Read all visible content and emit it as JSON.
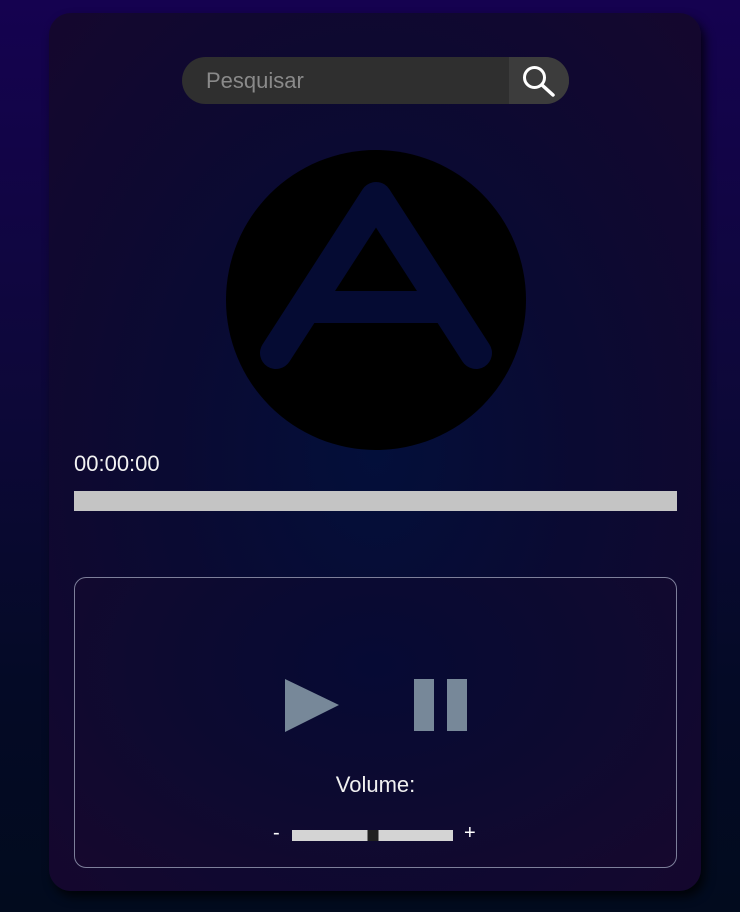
{
  "search": {
    "placeholder": "Pesquisar",
    "value": "",
    "icon": "search-icon"
  },
  "logo": {
    "icon": "letter-a-logo",
    "color": "#000000",
    "letter_color": "#050b33"
  },
  "player": {
    "time": "00:00:00",
    "progress": 0,
    "play_icon": "play-icon",
    "pause_icon": "pause-icon",
    "control_color": "#778899"
  },
  "volume": {
    "label": "Volume:",
    "minus": "-",
    "plus": "+",
    "level": 0.5
  }
}
